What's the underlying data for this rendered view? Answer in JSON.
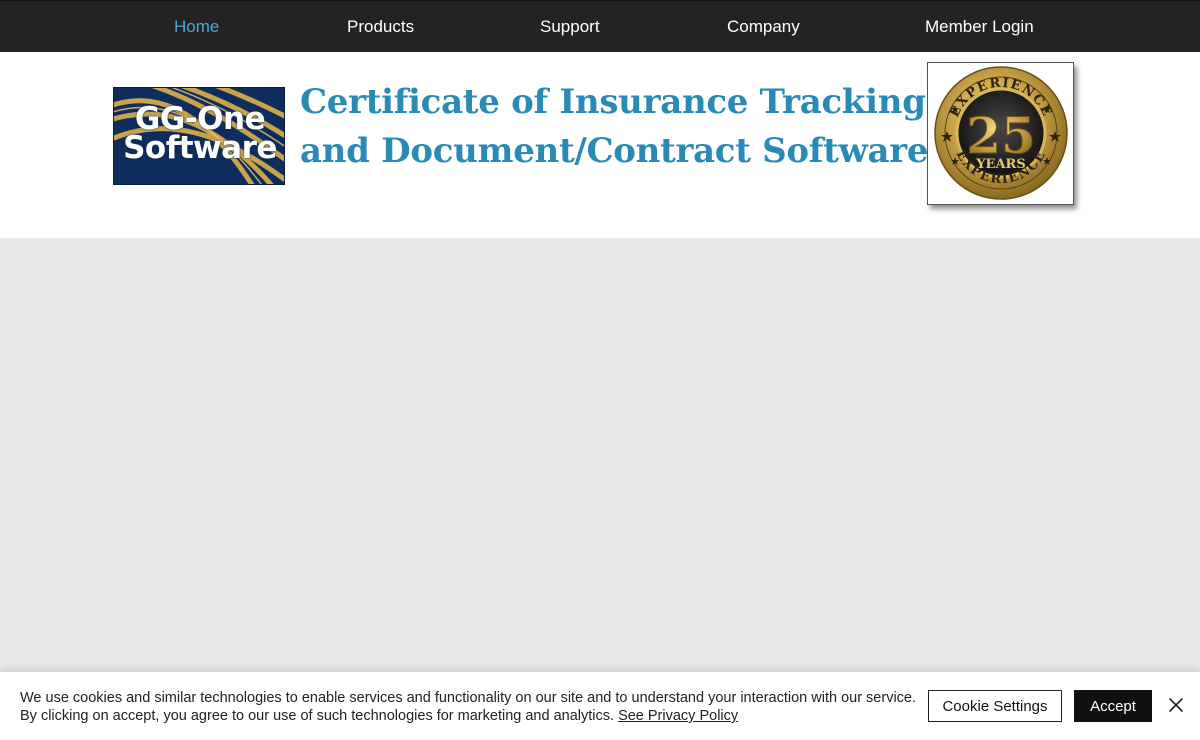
{
  "nav": {
    "items": [
      {
        "label": "Home",
        "active": true
      },
      {
        "label": "Products"
      },
      {
        "label": "Support"
      },
      {
        "label": "Company"
      },
      {
        "label": "Member Login"
      }
    ],
    "active_color": "#47a7dc"
  },
  "header": {
    "logo": {
      "line1": "GG-One",
      "line2": "Software"
    },
    "title_line1": "Certificate of Insurance Tracking",
    "title_line2": "and Document/Contract Software",
    "title_color": "#2a8ab6",
    "badge": {
      "top_text": "EXPERIENCE",
      "number": "25",
      "middle_text": "YEARS",
      "bottom_text": "EXPERIENCE"
    }
  },
  "cookie_banner": {
    "text_line1": "We use cookies and similar technologies to enable services and functionality on our site and to understand your interaction with our service.",
    "text_line2": "By clicking on accept, you agree to our use of such technologies for marketing and analytics.",
    "privacy_link": "See Privacy Policy",
    "settings_label": "Cookie Settings",
    "accept_label": "Accept"
  },
  "colors": {
    "nav_bg": "#232323",
    "content_bg": "#e8e8e8",
    "logo_bg": "#0f2d5c",
    "gold": "#c9a34a"
  }
}
